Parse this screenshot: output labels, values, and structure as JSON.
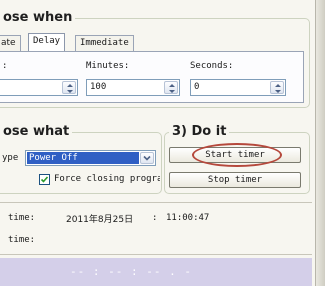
{
  "close_when": {
    "title": "ose when",
    "tabs": [
      "ate",
      "Delay",
      "Immediate"
    ],
    "active_tab": "Delay",
    "hours_label": ":",
    "minutes_label": "Minutes:",
    "seconds_label": "Seconds:",
    "minutes_value": "100",
    "seconds_value": "0"
  },
  "close_what": {
    "title": "ose what",
    "type_label": "ype",
    "type_value": "Power Off",
    "force_label": "Force closing program",
    "force_checked": true
  },
  "do_it": {
    "title": "3) Do it",
    "start_label": "Start timer",
    "stop_label": "Stop timer"
  },
  "times": {
    "current_label": "time:",
    "current_date": "2011年8月25日",
    "current_sep": ":",
    "current_time": "11:00:47",
    "target_label": "time:"
  },
  "countdown": {
    "text": "-- : -- : -- . -"
  }
}
